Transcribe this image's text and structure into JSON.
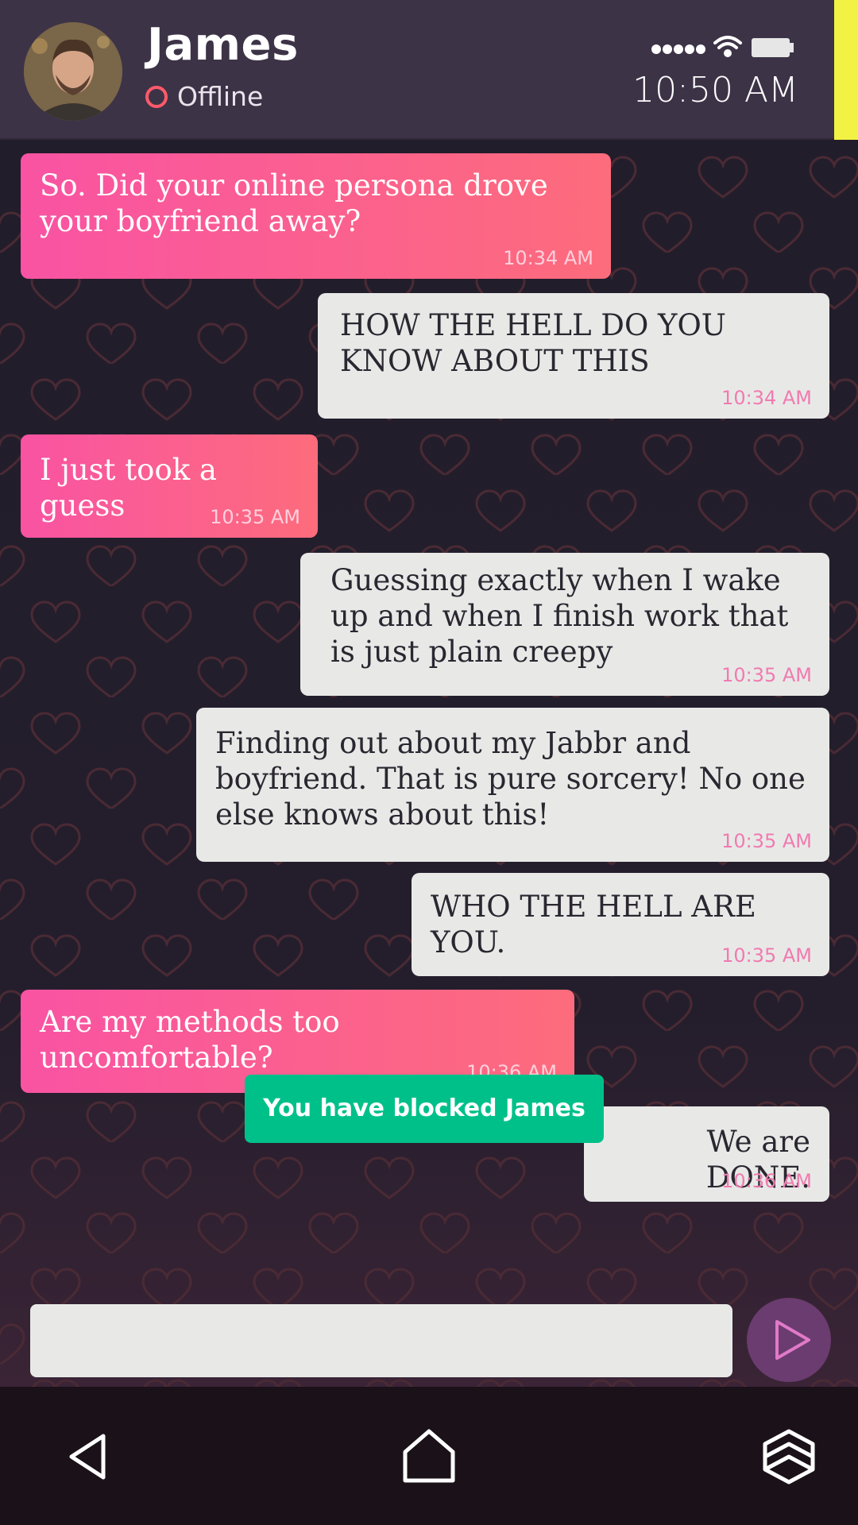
{
  "header": {
    "name": "James",
    "status": "Offline",
    "clock": "10:50 AM"
  },
  "messages": [
    {
      "from": "them",
      "text": "So. Did your online persona drove your boyfriend away?",
      "time": "10:34 AM"
    },
    {
      "from": "me",
      "text": "HOW THE HELL DO YOU KNOW ABOUT THIS",
      "time": "10:34 AM"
    },
    {
      "from": "them",
      "text": "I just took a guess",
      "time": "10:35 AM"
    },
    {
      "from": "me",
      "text": "Guessing exactly when I wake up and when I finish work that is just plain creepy",
      "time": "10:35 AM"
    },
    {
      "from": "me",
      "text": "Finding out about my Jabbr and boyfriend. That is pure sorcery! No one else knows about this!",
      "time": "10:35 AM"
    },
    {
      "from": "me",
      "text": "WHO THE HELL ARE YOU.",
      "time": "10:35 AM"
    },
    {
      "from": "them",
      "text": "Are my methods too uncomfortable?",
      "time": "10:36 AM"
    },
    {
      "from": "me",
      "text": "We are DONE.",
      "time": "10:36 AM"
    }
  ],
  "notice": {
    "blocked": "You have blocked James"
  },
  "composer": {
    "value": "",
    "placeholder": ""
  },
  "colors": {
    "their_bubble_start": "#f953a3",
    "their_bubble_end": "#fd6c7c",
    "my_bubble": "#e8e9e7",
    "blocked_badge": "#00c08a",
    "accent_bar": "#f2f244"
  },
  "icons": {
    "send": "send-arrow-icon",
    "nav_back": "back-icon",
    "nav_home": "home-icon",
    "nav_recents": "recents-icon",
    "status_signal": "signal-dots-icon",
    "status_wifi": "wifi-icon",
    "status_battery": "battery-icon"
  }
}
